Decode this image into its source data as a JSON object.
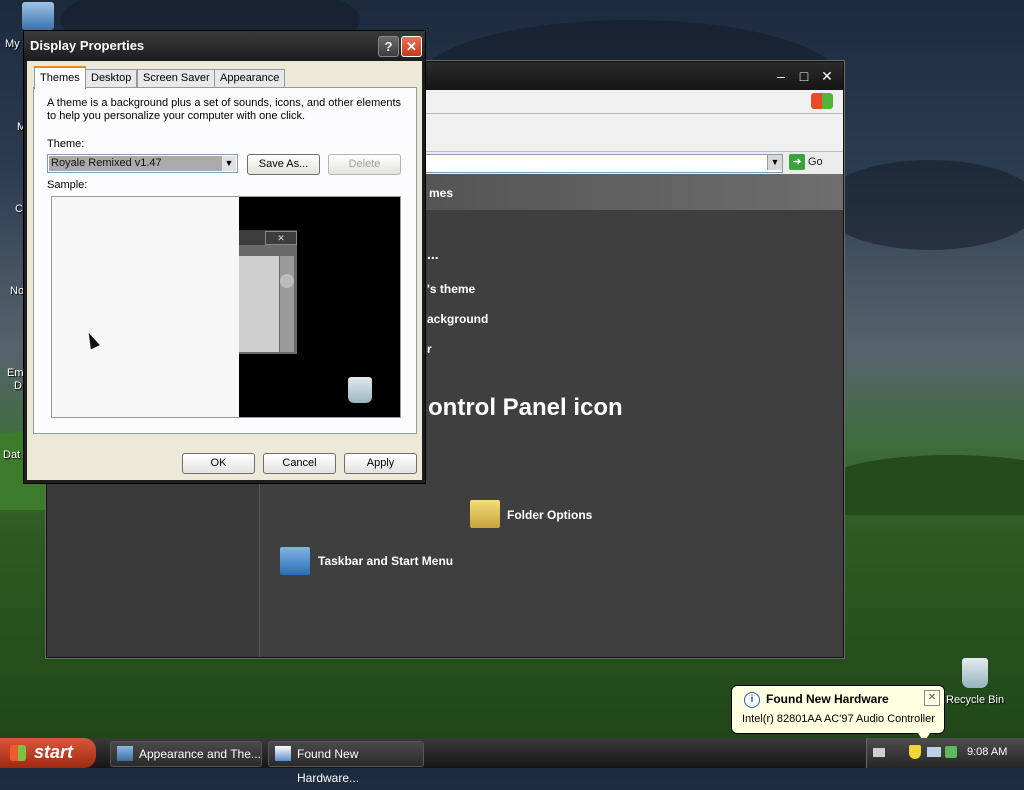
{
  "desktop": {
    "icons": [
      {
        "label": "My"
      },
      {
        "label": "M"
      },
      {
        "label": "C"
      },
      {
        "label": "No"
      },
      {
        "label": "Em"
      },
      {
        "label": "D"
      },
      {
        "label": "Dat"
      }
    ],
    "recycle_bin_label": "Recycle Bin"
  },
  "control_panel": {
    "go_label": "Go",
    "header_fragment": "mes",
    "tasks": [
      {
        "label": "..."
      },
      {
        "label": "'s theme"
      },
      {
        "label": "ackground"
      },
      {
        "label": "r"
      }
    ],
    "section_title": "ontrol Panel icon",
    "icons": [
      {
        "label": "Folder Options"
      },
      {
        "label": "Taskbar and Start Menu"
      }
    ]
  },
  "display_properties": {
    "title": "Display Properties",
    "help_label": "?",
    "close_label": "✕",
    "tabs": [
      {
        "label": "Themes",
        "active": true
      },
      {
        "label": "Desktop"
      },
      {
        "label": "Screen Saver"
      },
      {
        "label": "Appearance"
      }
    ],
    "description": "A theme is a background plus a set of sounds, icons, and other elements to help you personalize your computer with one click.",
    "theme_label": "Theme:",
    "theme_value": "Royale Remixed v1.47",
    "save_as_label": "Save As...",
    "delete_label": "Delete",
    "sample_label": "Sample:",
    "ok_label": "OK",
    "cancel_label": "Cancel",
    "apply_label": "Apply"
  },
  "taskbar": {
    "start_label": "start",
    "items": [
      {
        "label": "Appearance and The..."
      },
      {
        "label": "Found New Hardware..."
      }
    ],
    "clock": "9:08 AM"
  },
  "balloon": {
    "title": "Found New Hardware",
    "message": "Intel(r) 82801AA AC'97 Audio Controller"
  }
}
